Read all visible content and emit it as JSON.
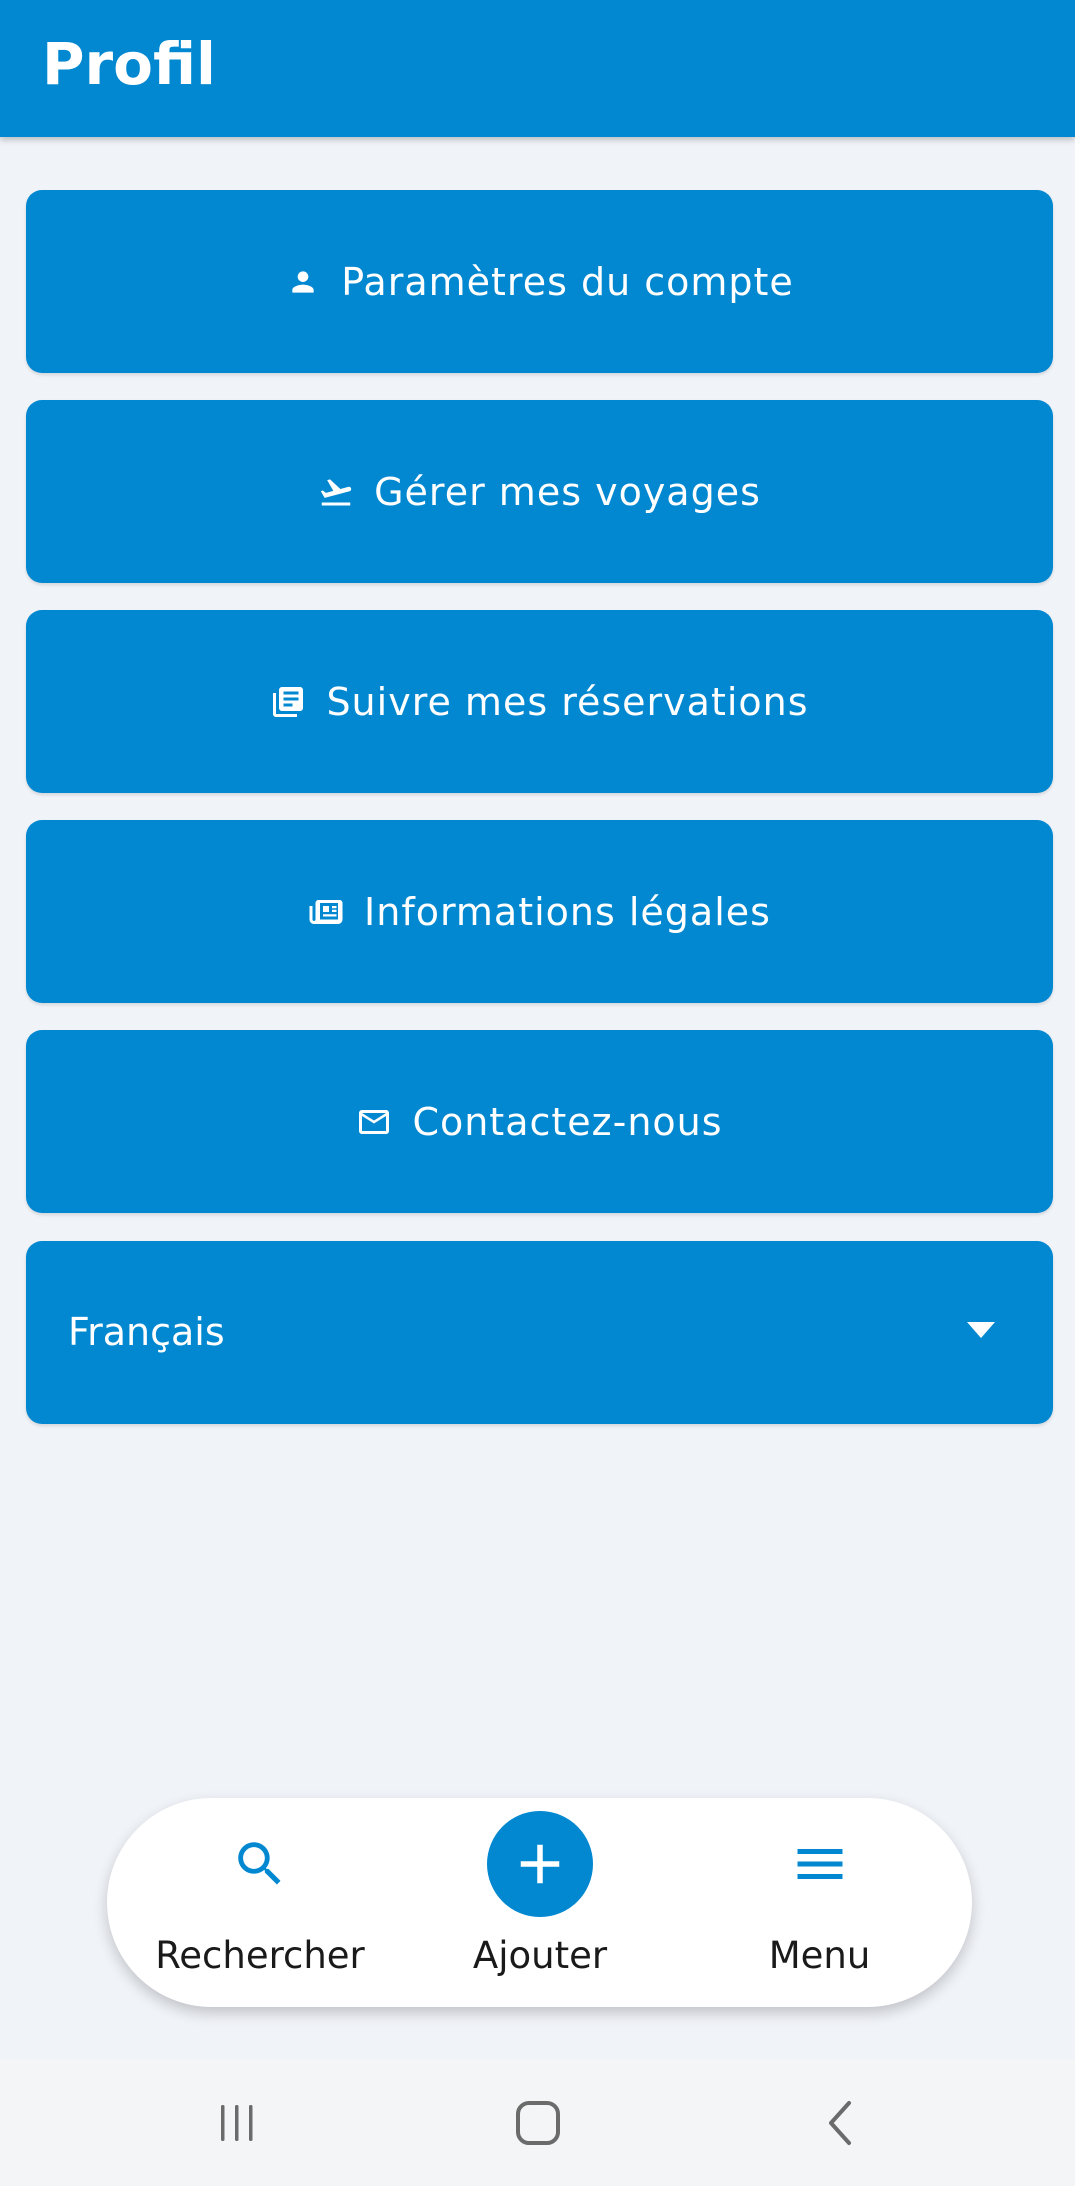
{
  "app_bar": {
    "title": "Profil"
  },
  "menu": {
    "items": [
      {
        "label": "Paramètres du compte",
        "icon": "person-icon"
      },
      {
        "label": "Gérer mes voyages",
        "icon": "flight-takeoff-icon"
      },
      {
        "label": "Suivre mes réservations",
        "icon": "library-books-icon"
      },
      {
        "label": "Informations légales",
        "icon": "newspaper-icon"
      },
      {
        "label": "Contactez-nous",
        "icon": "mail-icon"
      }
    ]
  },
  "language": {
    "selected": "Français"
  },
  "bottom_nav": {
    "items": [
      {
        "label": "Rechercher",
        "icon": "search-icon"
      },
      {
        "label": "Ajouter",
        "icon": "add-icon"
      },
      {
        "label": "Menu",
        "icon": "hamburger-menu-icon"
      }
    ]
  },
  "colors": {
    "primary": "#0288d1",
    "background": "#f0f3f8",
    "nav_background": "#ffffff",
    "text_on_primary": "#ffffff"
  }
}
